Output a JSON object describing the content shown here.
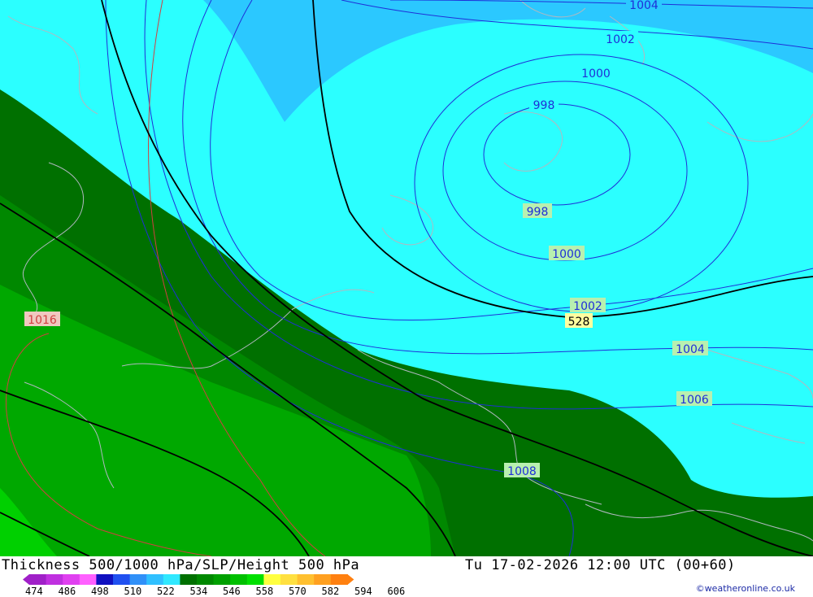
{
  "title": "Thickness 500/1000 hPa/SLP/Height 500 hPa",
  "datetime": "Tu 17-02-2026 12:00 UTC (00+60)",
  "credit": "©weatheronline.co.uk",
  "legend": {
    "ticks": [
      "474",
      "486",
      "498",
      "510",
      "522",
      "534",
      "546",
      "558",
      "570",
      "582",
      "594",
      "606"
    ],
    "colors": [
      "#a020c8",
      "#c030e0",
      "#e040f0",
      "#ff60ff",
      "#1010c0",
      "#2050f0",
      "#3090f8",
      "#30c0ff",
      "#30e8ff",
      "#007000",
      "#008800",
      "#00a000",
      "#00c000",
      "#00e000",
      "#ffff40",
      "#ffe040",
      "#ffc030",
      "#ffa020",
      "#ff8010"
    ]
  },
  "isobars": {
    "blue": [
      "1004",
      "1002",
      "1000",
      "998",
      "998",
      "1000",
      "1002",
      "1004",
      "1006",
      "1008"
    ],
    "red": [
      "1016"
    ]
  },
  "height_label": "528",
  "colors": {
    "sea_thin": "#2bffff",
    "sea_mid": "#2bc8ff",
    "green_dark": "#007000",
    "green_mid": "#008800",
    "green_light": "#00a800",
    "green_bright": "#00d000"
  }
}
